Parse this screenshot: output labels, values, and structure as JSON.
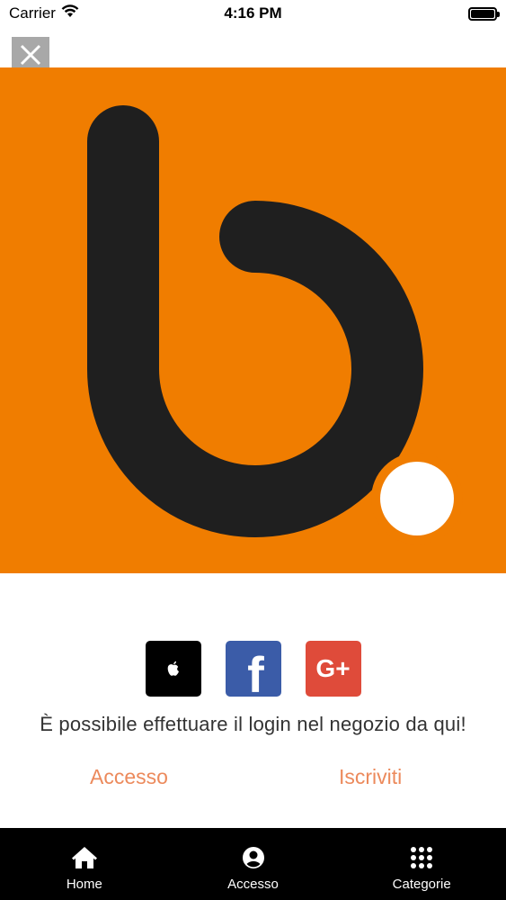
{
  "status_bar": {
    "carrier": "Carrier",
    "time": "4:16 PM",
    "battery_level": 1.0
  },
  "close_button": {
    "icon": "close-icon"
  },
  "banner": {
    "background_color": "#f07d00",
    "logo_color": "#1f1f1f",
    "dot_color": "#ffffff"
  },
  "social": {
    "buttons": [
      {
        "name": "apple",
        "icon": "apple-icon",
        "color": "#000000"
      },
      {
        "name": "facebook",
        "icon": "facebook-icon",
        "color": "#3b5ca8",
        "glyph": "f"
      },
      {
        "name": "google-plus",
        "icon": "google-plus-icon",
        "color": "#df4b3a",
        "glyph": "G+"
      }
    ]
  },
  "login_message": "È possibile effettuare il login nel negozio da qui!",
  "actions": {
    "login_label": "Accesso",
    "signup_label": "Iscriviti",
    "accent_color": "#ec8a5c"
  },
  "tab_bar": {
    "items": [
      {
        "label": "Home",
        "icon": "home-icon"
      },
      {
        "label": "Accesso",
        "icon": "account-icon"
      },
      {
        "label": "Categorie",
        "icon": "grid-icon"
      }
    ]
  }
}
